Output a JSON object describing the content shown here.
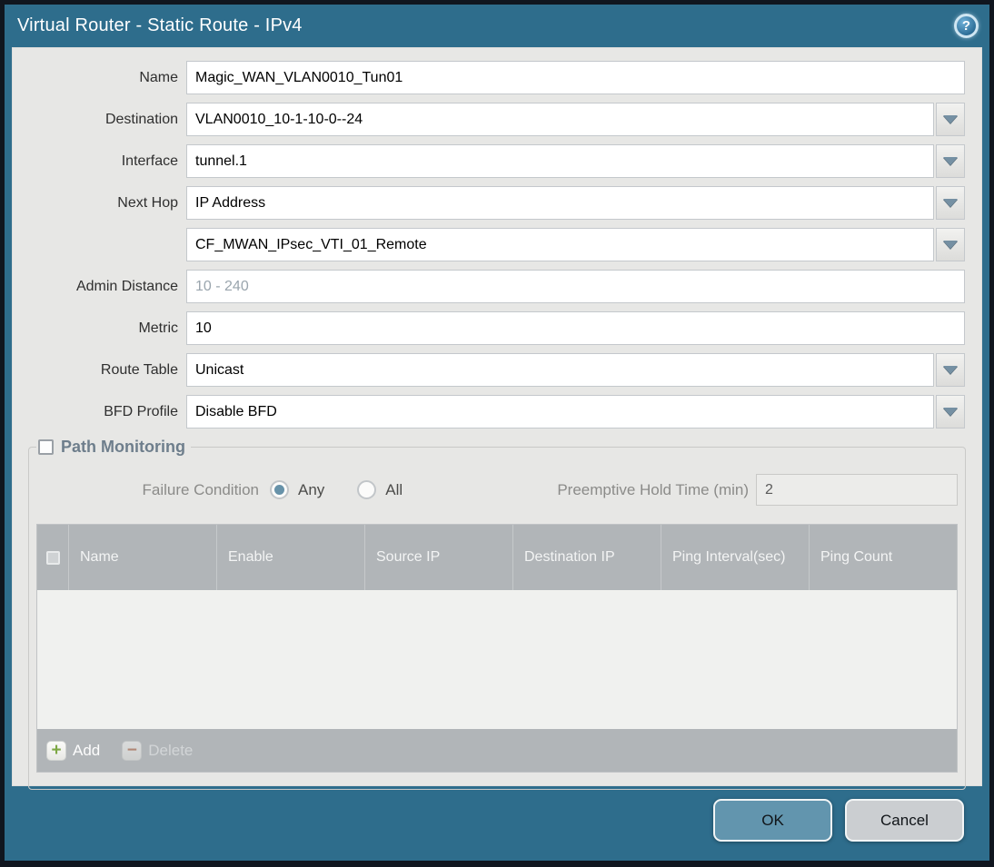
{
  "dialog": {
    "title": "Virtual Router - Static Route - IPv4",
    "help_icon_glyph": "?"
  },
  "form": {
    "fields": [
      {
        "label": "Name",
        "value": "Magic_WAN_VLAN0010_Tun01",
        "type": "text"
      },
      {
        "label": "Destination",
        "value": "VLAN0010_10-1-10-0--24",
        "type": "dropdown"
      },
      {
        "label": "Interface",
        "value": "tunnel.1",
        "type": "dropdown"
      },
      {
        "label": "Next Hop",
        "value": "IP Address",
        "type": "dropdown"
      },
      {
        "label": "",
        "value": "CF_MWAN_IPsec_VTI_01_Remote",
        "type": "dropdown"
      },
      {
        "label": "Admin Distance",
        "value": "",
        "placeholder": "10 - 240",
        "type": "text"
      },
      {
        "label": "Metric",
        "value": "10",
        "type": "text"
      },
      {
        "label": "Route Table",
        "value": "Unicast",
        "type": "dropdown"
      },
      {
        "label": "BFD Profile",
        "value": "Disable BFD",
        "type": "dropdown"
      }
    ]
  },
  "path_monitoring": {
    "legend": "Path Monitoring",
    "checkbox_checked": false,
    "failure_condition_label": "Failure Condition",
    "radio_options": [
      {
        "label": "Any",
        "selected": true
      },
      {
        "label": "All",
        "selected": false
      }
    ],
    "preemptive_label": "Preemptive Hold Time (min)",
    "preemptive_value": "2",
    "table": {
      "columns": [
        "Name",
        "Enable",
        "Source IP",
        "Destination IP",
        "Ping Interval(sec)",
        "Ping Count"
      ],
      "rows": [],
      "add_label": "Add",
      "delete_label": "Delete",
      "delete_enabled": false
    }
  },
  "footer": {
    "ok_label": "OK",
    "cancel_label": "Cancel"
  },
  "colors": {
    "titlebar_teal": "#2E6D8C",
    "content_bg": "#E7E7E5",
    "table_header_gray": "#B1B5B8",
    "table_body_bg": "#F0F1EF",
    "ok_button_bg": "#6295AE",
    "cancel_button_bg": "#CBCED1",
    "add_icon_green": "#7DA844",
    "delete_icon_red": "#B0603F",
    "radio_selected_blue": "#6792A9",
    "legend_text": "#6E7E8C"
  }
}
